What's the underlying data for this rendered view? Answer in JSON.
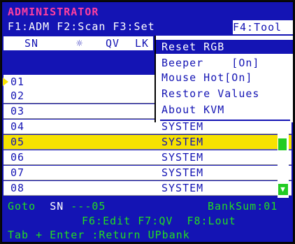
{
  "title": "ADMINISTRATOR",
  "menubar": {
    "f1": "F1:ADM",
    "f2": "F2:Scan",
    "f3": "F3:Set",
    "f4": "F4:Tool"
  },
  "table_header": {
    "sn": "SN",
    "brightness_icon": "☼",
    "qv": "QV",
    "lk": "LK"
  },
  "rows": [
    {
      "sn": "01",
      "name": ""
    },
    {
      "sn": "02",
      "name": ""
    },
    {
      "sn": "03",
      "name": ""
    },
    {
      "sn": "04",
      "name": "SYSTEM"
    },
    {
      "sn": "05",
      "name": "SYSTEM"
    },
    {
      "sn": "06",
      "name": "SYSTEM"
    },
    {
      "sn": "07",
      "name": "SYSTEM"
    },
    {
      "sn": "08",
      "name": "SYSTEM"
    }
  ],
  "selected_row": "05",
  "tool_menu": {
    "items": [
      "Reset RGB",
      "Beeper    [On]",
      "Mouse Hot[On]",
      "Restore Values",
      "About KVM"
    ],
    "highlighted": "Reset RGB"
  },
  "status": {
    "goto_label": "Goto",
    "sn_label": "SN",
    "goto_value": "---05",
    "banksum": "BankSum:01",
    "f6": "F6:Edit",
    "f7": "F7:QV",
    "f8": "F8:Lout",
    "tab_help": "Tab + Enter :Return UPbank"
  },
  "colors": {
    "background": "#1414b4",
    "title": "#ff3fa0",
    "selection": "#f6e200",
    "status_text": "#22dd22"
  },
  "icons": {
    "scroll_down": "▼"
  }
}
